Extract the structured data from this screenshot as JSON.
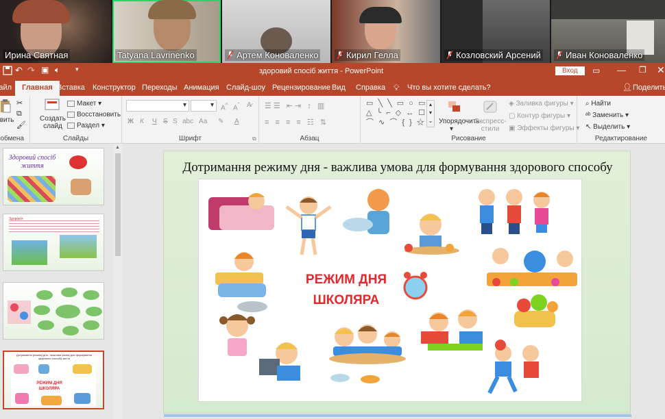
{
  "participants": [
    {
      "name": "Ирина Святная",
      "muted": false
    },
    {
      "name": "Tatyana Lavrinenko",
      "muted": false,
      "active_speaker": true
    },
    {
      "name": "Артем Коноваленко",
      "muted": true
    },
    {
      "name": "Кирил Гелла",
      "muted": true
    },
    {
      "name": "Козловский Арсений",
      "muted": true
    },
    {
      "name": "Иван Коноваленко",
      "muted": true
    }
  ],
  "titlebar": {
    "doc_title": "здоровий спосіб життя  -  PowerPoint",
    "signin_label": "Вход"
  },
  "tabs": [
    "Файл",
    "Главная",
    "Вставка",
    "Конструктор",
    "Переходы",
    "Анимация",
    "Слайд-шоу",
    "Рецензирование",
    "Вид",
    "Справка"
  ],
  "selected_tab": "Главная",
  "tellme_placeholder": "Что вы хотите сделать?",
  "share_label": "Поделиться",
  "ribbon": {
    "clipboard": {
      "paste": "Вставить",
      "label": "Буфер обмена"
    },
    "slides": {
      "new_slide": "Создать слайд",
      "layout": "Макет",
      "reset": "Восстановить",
      "section": "Раздел",
      "label": "Слайды"
    },
    "font": {
      "bold": "Ж",
      "italic": "К",
      "underline": "Ч",
      "strike": "S",
      "spacing": "abc",
      "case": "Аа",
      "label": "Шрифт"
    },
    "paragraph": {
      "label": "Абзац"
    },
    "drawing": {
      "arrange": "Упорядочить",
      "quick_styles": "Экспресс-стили",
      "fill": "Заливка фигуры",
      "outline": "Контур фигуры",
      "effects": "Эффекты фигуры",
      "label": "Рисование"
    },
    "editing": {
      "find": "Найти",
      "replace": "Заменить",
      "select": "Выделить",
      "label": "Редактирование"
    }
  },
  "thumbnails": [
    {
      "title": "Здоровий спосіб життя"
    },
    {
      "caption": "Здоров'я"
    },
    {
      "caption": ""
    },
    {
      "caption": "Дотримання режиму дня - важлива умова для формування здорового способу життя",
      "poster": "РЕЖИМ ДНЯ ШКОЛЯРА",
      "selected": true
    }
  ],
  "slide": {
    "title": "Дотримання режиму дня - важлива умова для формування здорового способу життя",
    "poster_line1": "РЕЖИМ ДНЯ",
    "poster_line2": "ШКОЛЯРА"
  },
  "colors": {
    "accent": "#b7472a",
    "speaker_outline": "#2bd46a",
    "poster_text": "#e8272c"
  }
}
